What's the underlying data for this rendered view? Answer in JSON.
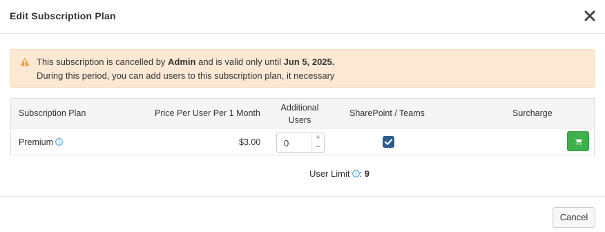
{
  "modal": {
    "title": "Edit Subscription Plan",
    "close_label": "✕"
  },
  "alert": {
    "line1_prefix": "This subscription is cancelled by ",
    "line1_actor": "Admin",
    "line1_middle": " and is valid only until ",
    "line1_date": "Jun 5, 2025.",
    "line2": "During this period, you can add users to this subscription plan, it necessary",
    "icon": "warning-icon",
    "color": "#fce8d3",
    "icon_color": "#f0a030"
  },
  "table": {
    "headers": {
      "plan": "Subscription Plan",
      "price": "Price Per User Per 1 Month",
      "additional": "Additional Users",
      "sharepoint": "SharePoint / Teams",
      "surcharge": "Surcharge"
    },
    "row": {
      "plan": "Premium",
      "price": "$3.00",
      "additional_users": "0",
      "stepper_up": "+",
      "stepper_down": "–",
      "sharepoint_checked": true,
      "surcharge_icon": "cart-icon"
    }
  },
  "user_limit": {
    "label": "User Limit",
    "separator": ":",
    "value": "9"
  },
  "footer": {
    "cancel_label": "Cancel"
  },
  "colors": {
    "checkbox": "#2c5b8c",
    "cart_button": "#3fb04b",
    "info": "#3a9fd6"
  }
}
